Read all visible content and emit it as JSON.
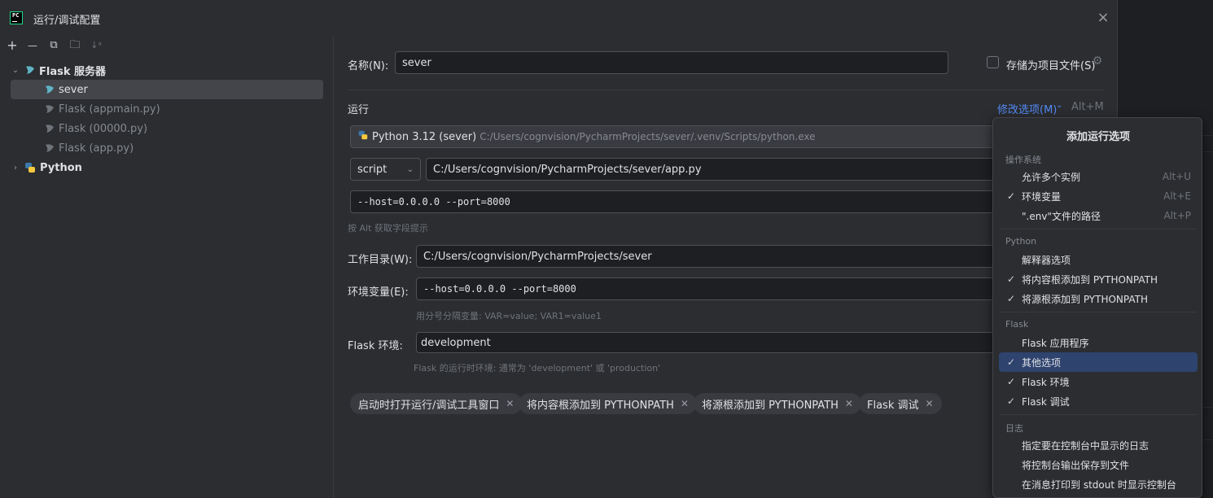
{
  "window": {
    "title": "运行/调试配置"
  },
  "toolbar": {
    "add": "+",
    "remove": "—",
    "copy": "⧉",
    "folder": "🗀",
    "sort": "↓ᵃ"
  },
  "tree": {
    "group_flask": "Flask 服务器",
    "items": [
      "sever",
      "Flask (appmain.py)",
      "Flask (00000.py)",
      "Flask (app.py)"
    ],
    "group_python": "Python"
  },
  "form": {
    "name_label": "名称(N):",
    "name_value": "sever",
    "store_label": "存储为项目文件(S)",
    "run_section": "运行",
    "modify_options": "修改选项(M)",
    "modify_shortcut": "Alt+M",
    "interpreter_name": "Python 3.12 (sever)",
    "interpreter_path": "C:/Users/cognvision/PycharmProjects/sever/.venv/Scripts/python.exe",
    "script_type": "script",
    "script_path": "C:/Users/cognvision/PycharmProjects/sever/app.py",
    "params": "--host=0.0.0.0 --port=8000",
    "params_hint": "按 Alt 获取字段提示",
    "workdir_label": "工作目录(W):",
    "workdir_value": "C:/Users/cognvision/PycharmProjects/sever",
    "env_label": "环境变量(E):",
    "env_value": "--host=0.0.0.0 --port=8000",
    "env_hint": "用分号分隔变量: VAR=value; VAR1=value1",
    "flask_env_label": "Flask 环境:",
    "flask_env_value": "development",
    "flask_env_hint": "Flask 的运行时环境: 通常为 'development' 或 'production'"
  },
  "tags": [
    "启动时打开运行/调试工具窗口",
    "将内容根添加到 PYTHONPATH",
    "将源根添加到 PYTHONPATH",
    "Flask 调试"
  ],
  "popup": {
    "title": "添加运行选项",
    "groups": {
      "os": "操作系统",
      "python": "Python",
      "flask": "Flask",
      "log": "日志"
    },
    "os_items": [
      {
        "label": "允许多个实例",
        "shortcut": "Alt+U",
        "checked": false
      },
      {
        "label": "环境变量",
        "shortcut": "Alt+E",
        "checked": true
      },
      {
        "label": "\".env\"文件的路径",
        "shortcut": "Alt+P",
        "checked": false
      }
    ],
    "python_items": [
      {
        "label": "解释器选项",
        "checked": false
      },
      {
        "label": "将内容根添加到 PYTHONPATH",
        "checked": true
      },
      {
        "label": "将源根添加到 PYTHONPATH",
        "checked": true
      }
    ],
    "flask_items": [
      {
        "label": "Flask 应用程序",
        "checked": false
      },
      {
        "label": "其他选项",
        "checked": true
      },
      {
        "label": "Flask 环境",
        "checked": true
      },
      {
        "label": "Flask 调试",
        "checked": true
      }
    ],
    "log_items": [
      {
        "label": "指定要在控制台中显示的日志",
        "checked": false
      },
      {
        "label": "将控制台输出保存到文件",
        "checked": false
      },
      {
        "label": "在消息打印到 stdout 时显示控制台",
        "checked": false
      }
    ]
  },
  "colors": {
    "accent": "#548af7",
    "highlight": "#2e436e",
    "background": "#2b2d30"
  }
}
